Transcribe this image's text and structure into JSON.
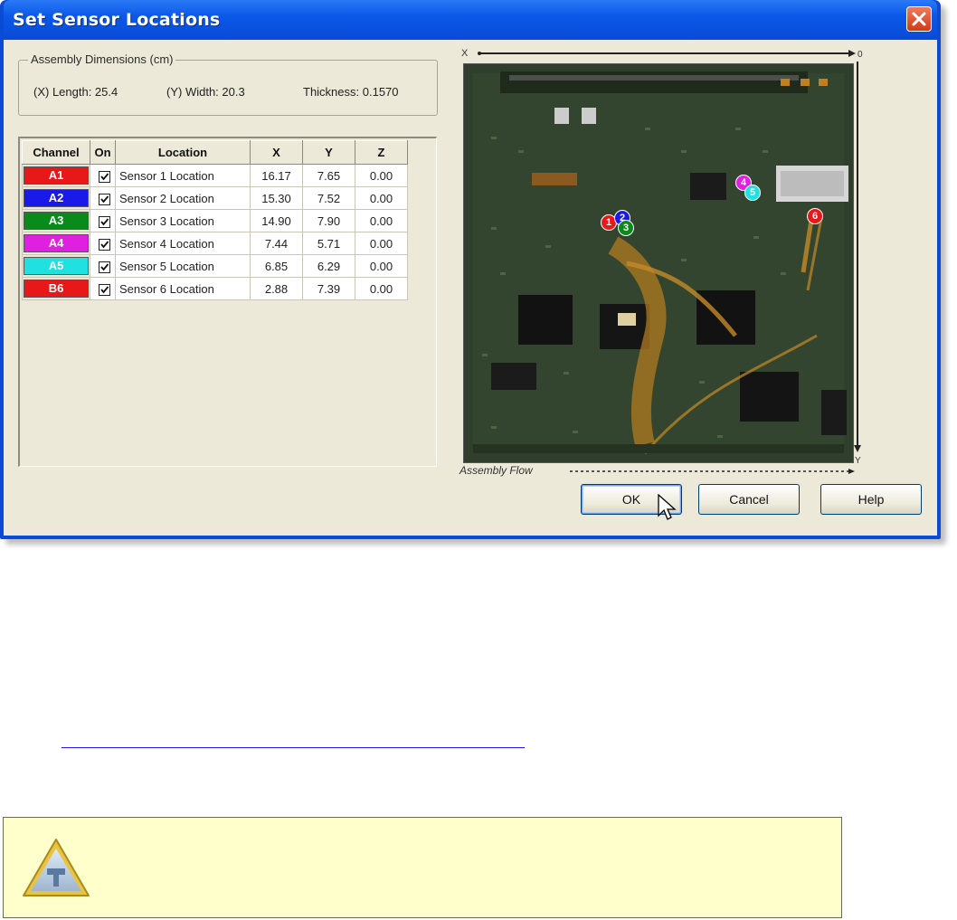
{
  "dialog": {
    "title": "Set Sensor Locations"
  },
  "dimensions": {
    "legend": "Assembly Dimensions (cm)",
    "length": "(X) Length: 25.4",
    "width": "(Y) Width:  20.3",
    "thickness": "Thickness: 0.1570"
  },
  "table": {
    "headers": [
      "Channel",
      "On",
      "Location",
      "X",
      "Y",
      "Z"
    ],
    "rows": [
      {
        "channel": "A1",
        "color": "#e81818",
        "on": true,
        "location": "Sensor 1 Location",
        "x": "16.17",
        "y": "7.65",
        "z": "0.00"
      },
      {
        "channel": "A2",
        "color": "#1a1ae8",
        "on": true,
        "location": "Sensor 2 Location",
        "x": "15.30",
        "y": "7.52",
        "z": "0.00"
      },
      {
        "channel": "A3",
        "color": "#0a8a1a",
        "on": true,
        "location": "Sensor 3 Location",
        "x": "14.90",
        "y": "7.90",
        "z": "0.00"
      },
      {
        "channel": "A4",
        "color": "#e020e0",
        "on": true,
        "location": "Sensor 4 Location",
        "x": "7.44",
        "y": "5.71",
        "z": "0.00"
      },
      {
        "channel": "A5",
        "color": "#20e0e0",
        "on": true,
        "location": "Sensor 5 Location",
        "x": "6.85",
        "y": "6.29",
        "z": "0.00"
      },
      {
        "channel": "B6",
        "color": "#e81818",
        "on": true,
        "location": "Sensor 6 Location",
        "x": "2.88",
        "y": "7.39",
        "z": "0.00"
      }
    ]
  },
  "board": {
    "axis_x": "X",
    "axis_origin": "0",
    "axis_y": "Y",
    "flow_label": "Assembly Flow",
    "markers": [
      {
        "label": "1",
        "color": "#e81818"
      },
      {
        "label": "2",
        "color": "#1a1ae8"
      },
      {
        "label": "3",
        "color": "#0a8a1a"
      },
      {
        "label": "4",
        "color": "#e020e0"
      },
      {
        "label": "5",
        "color": "#20e0e0"
      },
      {
        "label": "6",
        "color": "#e81818"
      }
    ]
  },
  "buttons": {
    "ok": "OK",
    "cancel": "Cancel",
    "help": "Help"
  }
}
